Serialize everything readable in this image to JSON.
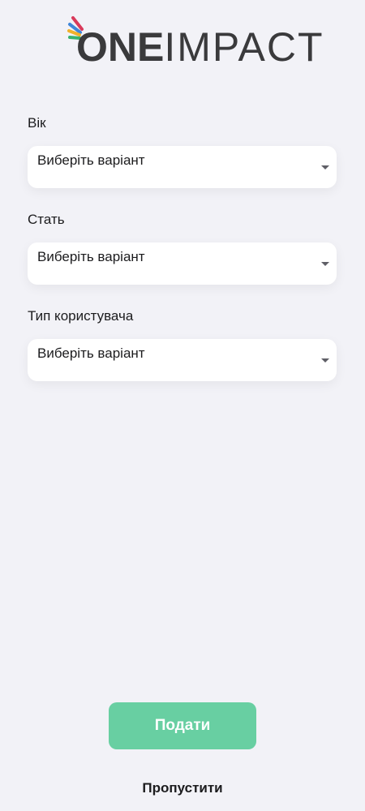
{
  "brand": {
    "logo_text_one": "ONE",
    "logo_text_impact": "IMPACT",
    "ray_colors": [
      "#d93a5b",
      "#3f86d9",
      "#f0b12a",
      "#37b26e",
      "#d9d9d9"
    ]
  },
  "form": {
    "fields": [
      {
        "label": "Вік",
        "placeholder": "Виберіть варіант",
        "icon": "chevron-down-icon"
      },
      {
        "label": "Стать",
        "placeholder": "Виберіть варіант",
        "icon": "chevron-down-icon"
      },
      {
        "label": "Тип користувача",
        "placeholder": "Виберіть варіант",
        "icon": "chevron-down-icon"
      }
    ]
  },
  "actions": {
    "submit_label": "Подати",
    "skip_label": "Пропустити",
    "submit_color": "#68cfa2"
  }
}
